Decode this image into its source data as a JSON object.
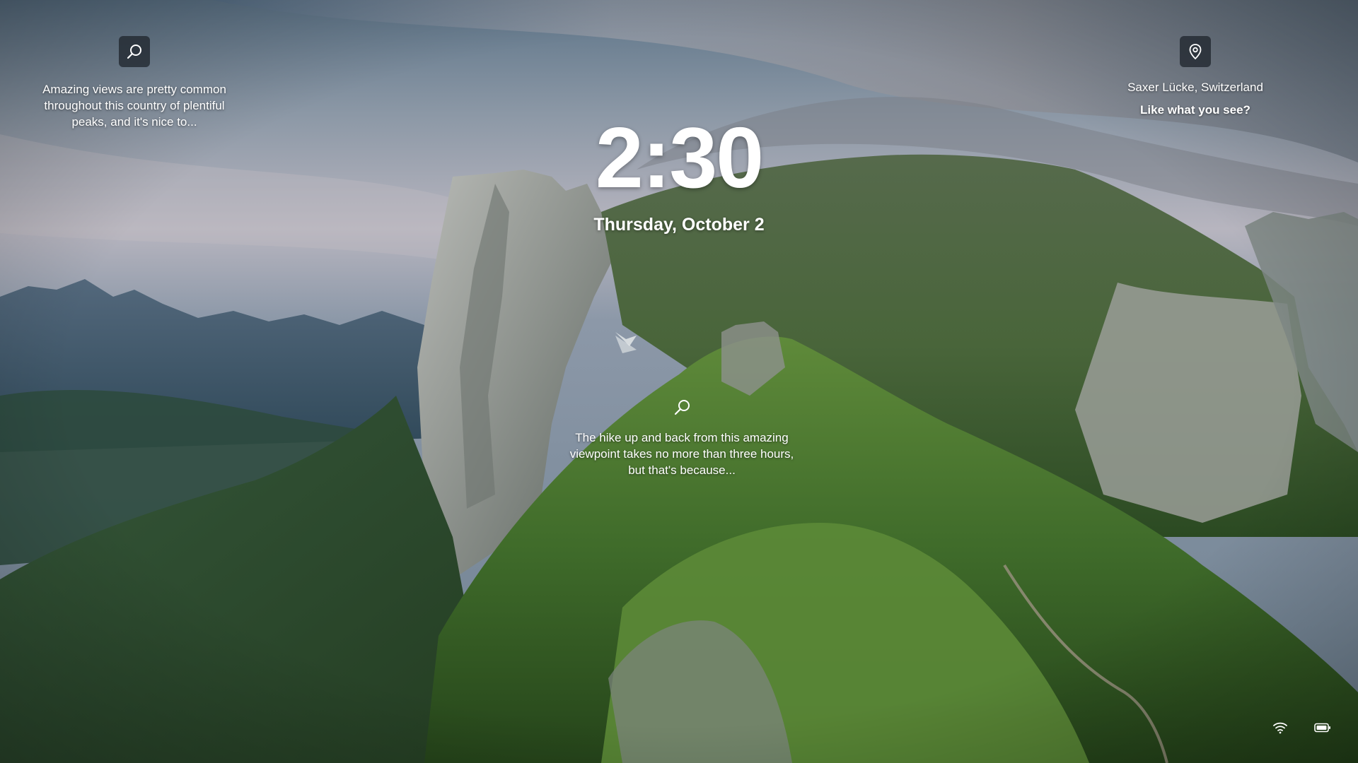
{
  "lockscreen": {
    "time": "2:30",
    "date": "Thursday, October 2"
  },
  "spotlight": {
    "left_tip": {
      "icon": "search-icon",
      "text": "Amazing views are pretty common throughout this country of plentiful peaks, and it's nice to..."
    },
    "center_tip": {
      "icon": "search-icon",
      "text": "The hike up and back from this amazing viewpoint takes no more than three hours, but that's because..."
    },
    "location": {
      "icon": "location-pin-icon",
      "title": "Saxer Lücke, Switzerland",
      "cta": "Like what you see?"
    }
  },
  "status_bar": {
    "icons": [
      "wifi-icon",
      "battery-icon"
    ]
  },
  "colors": {
    "text": "#ffffff",
    "icon_tile": "#20262e"
  }
}
